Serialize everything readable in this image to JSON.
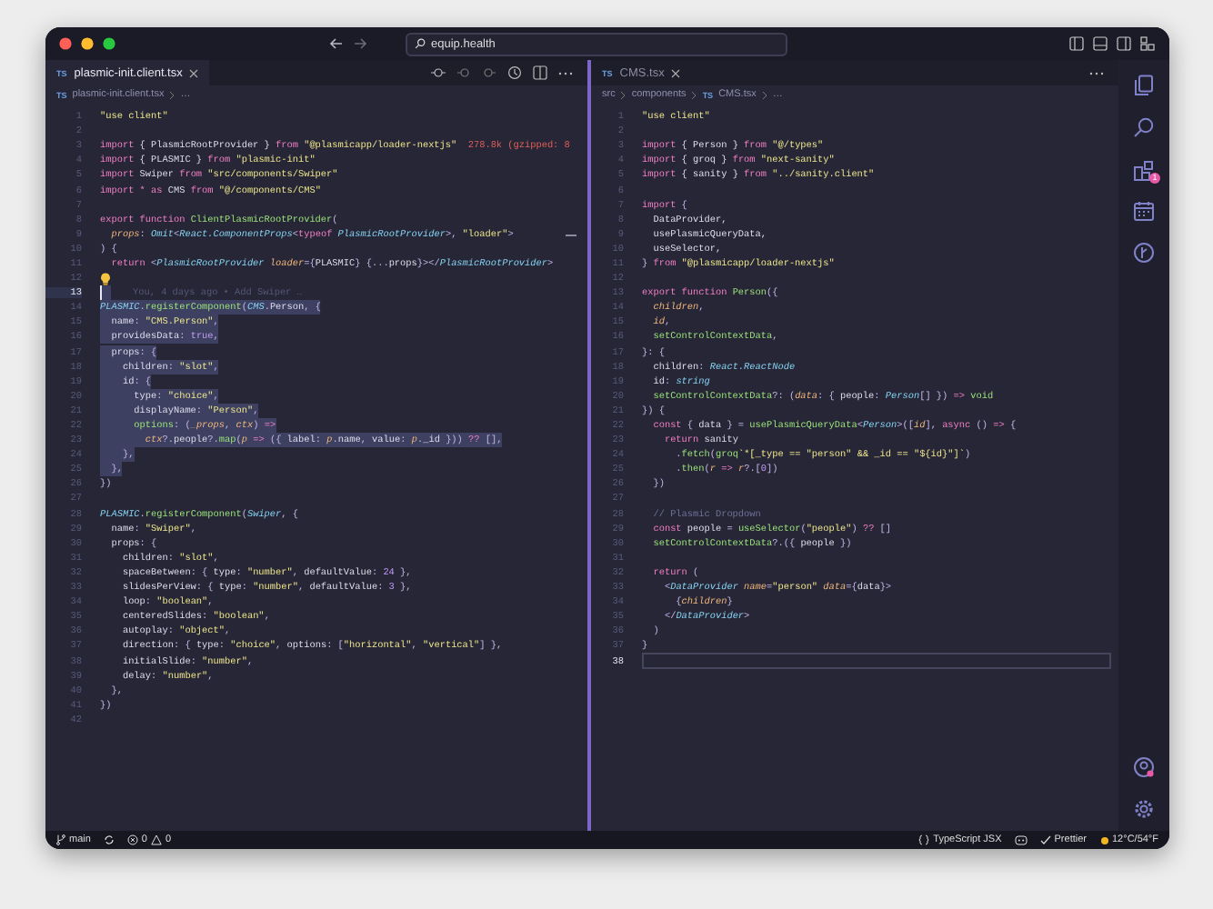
{
  "window": {
    "search": "equip.health"
  },
  "left_pane": {
    "tab": {
      "file_type": "TS",
      "label": "plasmic-init.client.tsx",
      "selected": true
    },
    "breadcrumb": {
      "file_type": "TS",
      "file": "plasmic-init.client.tsx",
      "rest": "…"
    },
    "lines": [
      {
        "number": "1",
        "kind": "code",
        "active": false,
        "selected": false,
        "tokens": [
          {
            "kind": "string",
            "text": "\"use client\""
          }
        ]
      },
      {
        "number": "2",
        "kind": "code",
        "active": false,
        "selected": false
      },
      {
        "number": "3",
        "kind": "code",
        "active": false,
        "selected": false,
        "tokens": [
          {
            "kind": "keyword",
            "text": "import"
          },
          {
            "kind": "plain",
            "text": " { PlasmicRootProvider } "
          },
          {
            "kind": "keyword",
            "text": "from"
          },
          {
            "kind": "string",
            "text": " \"@plasmicapp/loader-nextjs\""
          },
          {
            "kind": "cost",
            "text": "  278.8k (gzipped: 8"
          }
        ]
      },
      {
        "number": "4",
        "kind": "code",
        "active": false,
        "selected": false,
        "tokens": [
          {
            "kind": "keyword",
            "text": "import"
          },
          {
            "kind": "plain",
            "text": " { PLASMIC } "
          },
          {
            "kind": "keyword",
            "text": "from"
          },
          {
            "kind": "string",
            "text": " \"plasmic-init\""
          }
        ]
      },
      {
        "number": "5",
        "kind": "code",
        "active": false,
        "selected": false,
        "tokens": [
          {
            "kind": "keyword",
            "text": "import"
          },
          {
            "kind": "plain",
            "text": " Swiper "
          },
          {
            "kind": "keyword",
            "text": "from"
          },
          {
            "kind": "string",
            "text": " \"src/components/Swiper\""
          }
        ]
      },
      {
        "number": "6",
        "kind": "code",
        "active": false,
        "selected": false,
        "tokens": [
          {
            "kind": "keyword",
            "text": "import * as"
          },
          {
            "kind": "plain",
            "text": " CMS "
          },
          {
            "kind": "keyword",
            "text": "from"
          },
          {
            "kind": "string",
            "text": " \"@/components/CMS\""
          }
        ]
      },
      {
        "number": "7",
        "kind": "code",
        "active": false,
        "selected": false
      },
      {
        "number": "8",
        "kind": "code",
        "active": false,
        "selected": false,
        "tokens": [
          {
            "kind": "keyword",
            "text": "export function"
          },
          {
            "kind": "function",
            "text": " ClientPlasmicRootProvider"
          },
          {
            "kind": "punct",
            "text": "("
          }
        ]
      },
      {
        "number": "9",
        "kind": "code",
        "active": false,
        "selected": false,
        "tokens": [
          {
            "kind": "param",
            "text": "  props"
          },
          {
            "kind": "punct",
            "text": ": "
          },
          {
            "kind": "type",
            "text": "Omit"
          },
          {
            "kind": "punct",
            "text": "<"
          },
          {
            "kind": "type",
            "text": "React.ComponentProps"
          },
          {
            "kind": "punct",
            "text": "<"
          },
          {
            "kind": "keyword",
            "text": "typeof"
          },
          {
            "kind": "type",
            "text": " PlasmicRootProvider"
          },
          {
            "kind": "punct",
            "text": ">, "
          },
          {
            "kind": "string",
            "text": "\"loader\""
          },
          {
            "kind": "punct",
            "text": ">"
          }
        ]
      },
      {
        "number": "10",
        "kind": "code",
        "active": false,
        "selected": false,
        "tokens": [
          {
            "kind": "punct",
            "text": ") {"
          }
        ]
      },
      {
        "number": "11",
        "kind": "code",
        "active": false,
        "selected": false,
        "tokens": [
          {
            "kind": "keyword",
            "text": "  return"
          },
          {
            "kind": "punct",
            "text": " <"
          },
          {
            "kind": "type",
            "text": "PlasmicRootProvider"
          },
          {
            "kind": "param",
            "text": " loader"
          },
          {
            "kind": "punct",
            "text": "={"
          },
          {
            "kind": "plain",
            "text": "PLASMIC"
          },
          {
            "kind": "punct",
            "text": "} {..."
          },
          {
            "kind": "plain",
            "text": "props"
          },
          {
            "kind": "punct",
            "text": "}></"
          },
          {
            "kind": "type",
            "text": "PlasmicRootProvider"
          },
          {
            "kind": "punct",
            "text": ">"
          }
        ]
      },
      {
        "number": "12",
        "kind": "hint",
        "active": false,
        "selected": false
      },
      {
        "number": "13",
        "kind": "blame",
        "active": true,
        "selected": true,
        "blame": "You, 4 days ago • Add Swiper …"
      },
      {
        "number": "14",
        "kind": "code",
        "active": false,
        "selected": true,
        "tokens": [
          {
            "kind": "type",
            "text": "PLASMIC"
          },
          {
            "kind": "punct",
            "text": "."
          },
          {
            "kind": "function",
            "text": "registerComponent"
          },
          {
            "kind": "punct",
            "text": "("
          },
          {
            "kind": "type",
            "text": "CMS"
          },
          {
            "kind": "punct",
            "text": "."
          },
          {
            "kind": "plain",
            "text": "Person"
          },
          {
            "kind": "punct",
            "text": ", {"
          }
        ]
      },
      {
        "number": "15",
        "kind": "code",
        "active": false,
        "selected": true,
        "tokens": [
          {
            "kind": "plain",
            "text": "  name"
          },
          {
            "kind": "punct",
            "text": ": "
          },
          {
            "kind": "string",
            "text": "\"CMS.Person\""
          },
          {
            "kind": "punct",
            "text": ","
          }
        ]
      },
      {
        "number": "16",
        "kind": "code",
        "active": false,
        "selected": true,
        "tokens": [
          {
            "kind": "plain",
            "text": "  providesData"
          },
          {
            "kind": "punct",
            "text": ": "
          },
          {
            "kind": "number",
            "text": "true"
          },
          {
            "kind": "punct",
            "text": ","
          }
        ]
      },
      {
        "number": "17",
        "kind": "code",
        "active": false,
        "selected": true,
        "tokens": [
          {
            "kind": "plain",
            "text": "  props"
          },
          {
            "kind": "punct",
            "text": ": {"
          }
        ]
      },
      {
        "number": "18",
        "kind": "code",
        "active": false,
        "selected": true,
        "tokens": [
          {
            "kind": "plain",
            "text": "    children"
          },
          {
            "kind": "punct",
            "text": ": "
          },
          {
            "kind": "string",
            "text": "\"slot\""
          },
          {
            "kind": "punct",
            "text": ","
          }
        ]
      },
      {
        "number": "19",
        "kind": "code",
        "active": false,
        "selected": true,
        "tokens": [
          {
            "kind": "plain",
            "text": "    id"
          },
          {
            "kind": "punct",
            "text": ": {"
          }
        ]
      },
      {
        "number": "20",
        "kind": "code",
        "active": false,
        "selected": true,
        "tokens": [
          {
            "kind": "plain",
            "text": "      type"
          },
          {
            "kind": "punct",
            "text": ": "
          },
          {
            "kind": "string",
            "text": "\"choice\""
          },
          {
            "kind": "punct",
            "text": ","
          }
        ]
      },
      {
        "number": "21",
        "kind": "code",
        "active": false,
        "selected": true,
        "tokens": [
          {
            "kind": "plain",
            "text": "      displayName"
          },
          {
            "kind": "punct",
            "text": ": "
          },
          {
            "kind": "string",
            "text": "\"Person\""
          },
          {
            "kind": "punct",
            "text": ","
          }
        ]
      },
      {
        "number": "22",
        "kind": "code",
        "active": false,
        "selected": true,
        "tokens": [
          {
            "kind": "function",
            "text": "      options"
          },
          {
            "kind": "punct",
            "text": ": ("
          },
          {
            "kind": "param",
            "text": "_props"
          },
          {
            "kind": "punct",
            "text": ", "
          },
          {
            "kind": "param",
            "text": "ctx"
          },
          {
            "kind": "punct",
            "text": ") "
          },
          {
            "kind": "keyword",
            "text": "=>"
          }
        ]
      },
      {
        "number": "23",
        "kind": "code",
        "active": false,
        "selected": true,
        "tokens": [
          {
            "kind": "param",
            "text": "        ctx"
          },
          {
            "kind": "punct",
            "text": "?."
          },
          {
            "kind": "plain",
            "text": "people"
          },
          {
            "kind": "punct",
            "text": "?."
          },
          {
            "kind": "function",
            "text": "map"
          },
          {
            "kind": "punct",
            "text": "("
          },
          {
            "kind": "param",
            "text": "p"
          },
          {
            "kind": "keyword",
            "text": " =>"
          },
          {
            "kind": "punct",
            "text": " ({ "
          },
          {
            "kind": "plain",
            "text": "label"
          },
          {
            "kind": "punct",
            "text": ": "
          },
          {
            "kind": "param",
            "text": "p"
          },
          {
            "kind": "punct",
            "text": "."
          },
          {
            "kind": "plain",
            "text": "name"
          },
          {
            "kind": "punct",
            "text": ", "
          },
          {
            "kind": "plain",
            "text": "value"
          },
          {
            "kind": "punct",
            "text": ": "
          },
          {
            "kind": "param",
            "text": "p"
          },
          {
            "kind": "punct",
            "text": "."
          },
          {
            "kind": "plain",
            "text": "_id"
          },
          {
            "kind": "punct",
            "text": " })) "
          },
          {
            "kind": "keyword",
            "text": "??"
          },
          {
            "kind": "punct",
            "text": " [],"
          }
        ]
      },
      {
        "number": "24",
        "kind": "code",
        "active": false,
        "selected": true,
        "tokens": [
          {
            "kind": "punct",
            "text": "    },"
          }
        ]
      },
      {
        "number": "25",
        "kind": "code",
        "active": false,
        "selected": true,
        "tokens": [
          {
            "kind": "punct",
            "text": "  },"
          }
        ]
      },
      {
        "number": "26",
        "kind": "code",
        "active": false,
        "selected": false,
        "tokens": [
          {
            "kind": "punct",
            "text": "})"
          }
        ]
      },
      {
        "number": "27",
        "kind": "code",
        "active": false,
        "selected": false
      },
      {
        "number": "28",
        "kind": "code",
        "active": false,
        "selected": false,
        "tokens": [
          {
            "kind": "type",
            "text": "PLASMIC"
          },
          {
            "kind": "punct",
            "text": "."
          },
          {
            "kind": "function",
            "text": "registerComponent"
          },
          {
            "kind": "punct",
            "text": "("
          },
          {
            "kind": "type",
            "text": "Swiper"
          },
          {
            "kind": "punct",
            "text": ", {"
          }
        ]
      },
      {
        "number": "29",
        "kind": "code",
        "active": false,
        "selected": false,
        "tokens": [
          {
            "kind": "plain",
            "text": "  name"
          },
          {
            "kind": "punct",
            "text": ": "
          },
          {
            "kind": "string",
            "text": "\"Swiper\""
          },
          {
            "kind": "punct",
            "text": ","
          }
        ]
      },
      {
        "number": "30",
        "kind": "code",
        "active": false,
        "selected": false,
        "tokens": [
          {
            "kind": "plain",
            "text": "  props"
          },
          {
            "kind": "punct",
            "text": ": {"
          }
        ]
      },
      {
        "number": "31",
        "kind": "code",
        "active": false,
        "selected": false,
        "tokens": [
          {
            "kind": "plain",
            "text": "    children"
          },
          {
            "kind": "punct",
            "text": ": "
          },
          {
            "kind": "string",
            "text": "\"slot\""
          },
          {
            "kind": "punct",
            "text": ","
          }
        ]
      },
      {
        "number": "32",
        "kind": "code",
        "active": false,
        "selected": false,
        "tokens": [
          {
            "kind": "plain",
            "text": "    spaceBetween"
          },
          {
            "kind": "punct",
            "text": ": { "
          },
          {
            "kind": "plain",
            "text": "type"
          },
          {
            "kind": "punct",
            "text": ": "
          },
          {
            "kind": "string",
            "text": "\"number\""
          },
          {
            "kind": "punct",
            "text": ", "
          },
          {
            "kind": "plain",
            "text": "defaultValue"
          },
          {
            "kind": "punct",
            "text": ": "
          },
          {
            "kind": "number",
            "text": "24"
          },
          {
            "kind": "punct",
            "text": " },"
          }
        ]
      },
      {
        "number": "33",
        "kind": "code",
        "active": false,
        "selected": false,
        "tokens": [
          {
            "kind": "plain",
            "text": "    slidesPerView"
          },
          {
            "kind": "punct",
            "text": ": { "
          },
          {
            "kind": "plain",
            "text": "type"
          },
          {
            "kind": "punct",
            "text": ": "
          },
          {
            "kind": "string",
            "text": "\"number\""
          },
          {
            "kind": "punct",
            "text": ", "
          },
          {
            "kind": "plain",
            "text": "defaultValue"
          },
          {
            "kind": "punct",
            "text": ": "
          },
          {
            "kind": "number",
            "text": "3"
          },
          {
            "kind": "punct",
            "text": " },"
          }
        ]
      },
      {
        "number": "34",
        "kind": "code",
        "active": false,
        "selected": false,
        "tokens": [
          {
            "kind": "plain",
            "text": "    loop"
          },
          {
            "kind": "punct",
            "text": ": "
          },
          {
            "kind": "string",
            "text": "\"boolean\""
          },
          {
            "kind": "punct",
            "text": ","
          }
        ]
      },
      {
        "number": "35",
        "kind": "code",
        "active": false,
        "selected": false,
        "tokens": [
          {
            "kind": "plain",
            "text": "    centeredSlides"
          },
          {
            "kind": "punct",
            "text": ": "
          },
          {
            "kind": "string",
            "text": "\"boolean\""
          },
          {
            "kind": "punct",
            "text": ","
          }
        ]
      },
      {
        "number": "36",
        "kind": "code",
        "active": false,
        "selected": false,
        "tokens": [
          {
            "kind": "plain",
            "text": "    autoplay"
          },
          {
            "kind": "punct",
            "text": ": "
          },
          {
            "kind": "string",
            "text": "\"object\""
          },
          {
            "kind": "punct",
            "text": ","
          }
        ]
      },
      {
        "number": "37",
        "kind": "code",
        "active": false,
        "selected": false,
        "tokens": [
          {
            "kind": "plain",
            "text": "    direction"
          },
          {
            "kind": "punct",
            "text": ": { "
          },
          {
            "kind": "plain",
            "text": "type"
          },
          {
            "kind": "punct",
            "text": ": "
          },
          {
            "kind": "string",
            "text": "\"choice\""
          },
          {
            "kind": "punct",
            "text": ", "
          },
          {
            "kind": "plain",
            "text": "options"
          },
          {
            "kind": "punct",
            "text": ": ["
          },
          {
            "kind": "string",
            "text": "\"horizontal\""
          },
          {
            "kind": "punct",
            "text": ", "
          },
          {
            "kind": "string",
            "text": "\"vertical\""
          },
          {
            "kind": "punct",
            "text": "] },"
          }
        ]
      },
      {
        "number": "38",
        "kind": "code",
        "active": false,
        "selected": false,
        "tokens": [
          {
            "kind": "plain",
            "text": "    initialSlide"
          },
          {
            "kind": "punct",
            "text": ": "
          },
          {
            "kind": "string",
            "text": "\"number\""
          },
          {
            "kind": "punct",
            "text": ","
          }
        ]
      },
      {
        "number": "39",
        "kind": "code",
        "active": false,
        "selected": false,
        "tokens": [
          {
            "kind": "plain",
            "text": "    delay"
          },
          {
            "kind": "punct",
            "text": ": "
          },
          {
            "kind": "string",
            "text": "\"number\""
          },
          {
            "kind": "punct",
            "text": ","
          }
        ]
      },
      {
        "number": "40",
        "kind": "code",
        "active": false,
        "selected": false,
        "tokens": [
          {
            "kind": "punct",
            "text": "  },"
          }
        ]
      },
      {
        "number": "41",
        "kind": "code",
        "active": false,
        "selected": false,
        "tokens": [
          {
            "kind": "punct",
            "text": "})"
          }
        ]
      },
      {
        "number": "42",
        "kind": "code",
        "active": false,
        "selected": false
      }
    ]
  },
  "right_pane": {
    "tab": {
      "file_type": "TS",
      "label": "CMS.tsx",
      "selected": false
    },
    "breadcrumb": {
      "path": [
        "src",
        "components"
      ],
      "file_type": "TS",
      "file": "CMS.tsx",
      "rest": "…"
    },
    "lines": [
      {
        "number": "1",
        "kind": "code",
        "active": false,
        "selected": false,
        "tokens": [
          {
            "kind": "string",
            "text": "\"use client\""
          }
        ]
      },
      {
        "number": "2",
        "kind": "code",
        "active": false,
        "selected": false
      },
      {
        "number": "3",
        "kind": "code",
        "active": false,
        "selected": false,
        "tokens": [
          {
            "kind": "keyword",
            "text": "import"
          },
          {
            "kind": "plain",
            "text": " { Person } "
          },
          {
            "kind": "keyword",
            "text": "from"
          },
          {
            "kind": "string",
            "text": " \"@/types\""
          }
        ]
      },
      {
        "number": "4",
        "kind": "code",
        "active": false,
        "selected": false,
        "tokens": [
          {
            "kind": "keyword",
            "text": "import"
          },
          {
            "kind": "plain",
            "text": " { groq } "
          },
          {
            "kind": "keyword",
            "text": "from"
          },
          {
            "kind": "string",
            "text": " \"next-sanity\""
          }
        ]
      },
      {
        "number": "5",
        "kind": "code",
        "active": false,
        "selected": false,
        "tokens": [
          {
            "kind": "keyword",
            "text": "import"
          },
          {
            "kind": "plain",
            "text": " { sanity } "
          },
          {
            "kind": "keyword",
            "text": "from"
          },
          {
            "kind": "string",
            "text": " \"../sanity.client\""
          }
        ]
      },
      {
        "number": "6",
        "kind": "code",
        "active": false,
        "selected": false
      },
      {
        "number": "7",
        "kind": "code",
        "active": false,
        "selected": false,
        "tokens": [
          {
            "kind": "keyword",
            "text": "import"
          },
          {
            "kind": "punct",
            "text": " {"
          }
        ]
      },
      {
        "number": "8",
        "kind": "code",
        "active": false,
        "selected": false,
        "tokens": [
          {
            "kind": "plain",
            "text": "  DataProvider,"
          }
        ]
      },
      {
        "number": "9",
        "kind": "code",
        "active": false,
        "selected": false,
        "tokens": [
          {
            "kind": "plain",
            "text": "  usePlasmicQueryData,"
          }
        ]
      },
      {
        "number": "10",
        "kind": "code",
        "active": false,
        "selected": false,
        "tokens": [
          {
            "kind": "plain",
            "text": "  useSelector,"
          }
        ]
      },
      {
        "number": "11",
        "kind": "code",
        "active": false,
        "selected": false,
        "tokens": [
          {
            "kind": "punct",
            "text": "} "
          },
          {
            "kind": "keyword",
            "text": "from"
          },
          {
            "kind": "string",
            "text": " \"@plasmicapp/loader-nextjs\""
          }
        ]
      },
      {
        "number": "12",
        "kind": "code",
        "active": false,
        "selected": false
      },
      {
        "number": "13",
        "kind": "code",
        "active": false,
        "selected": false,
        "tokens": [
          {
            "kind": "keyword",
            "text": "export function"
          },
          {
            "kind": "function",
            "text": " Person"
          },
          {
            "kind": "punct",
            "text": "({"
          }
        ]
      },
      {
        "number": "14",
        "kind": "code",
        "active": false,
        "selected": false,
        "tokens": [
          {
            "kind": "param",
            "text": "  children"
          },
          {
            "kind": "punct",
            "text": ","
          }
        ]
      },
      {
        "number": "15",
        "kind": "code",
        "active": false,
        "selected": false,
        "tokens": [
          {
            "kind": "param",
            "text": "  id"
          },
          {
            "kind": "punct",
            "text": ","
          }
        ]
      },
      {
        "number": "16",
        "kind": "code",
        "active": false,
        "selected": false,
        "tokens": [
          {
            "kind": "function",
            "text": "  setControlContextData"
          },
          {
            "kind": "punct",
            "text": ","
          }
        ]
      },
      {
        "number": "17",
        "kind": "code",
        "active": false,
        "selected": false,
        "tokens": [
          {
            "kind": "punct",
            "text": "}: {"
          }
        ]
      },
      {
        "number": "18",
        "kind": "code",
        "active": false,
        "selected": false,
        "tokens": [
          {
            "kind": "plain",
            "text": "  children"
          },
          {
            "kind": "punct",
            "text": ": "
          },
          {
            "kind": "type",
            "text": "React.ReactNode"
          }
        ]
      },
      {
        "number": "19",
        "kind": "code",
        "active": false,
        "selected": false,
        "tokens": [
          {
            "kind": "plain",
            "text": "  id"
          },
          {
            "kind": "punct",
            "text": ": "
          },
          {
            "kind": "type",
            "text": "string"
          }
        ]
      },
      {
        "number": "20",
        "kind": "code",
        "active": false,
        "selected": false,
        "tokens": [
          {
            "kind": "function",
            "text": "  setControlContextData"
          },
          {
            "kind": "punct",
            "text": "?: ("
          },
          {
            "kind": "param",
            "text": "data"
          },
          {
            "kind": "punct",
            "text": ": { "
          },
          {
            "kind": "plain",
            "text": "people"
          },
          {
            "kind": "punct",
            "text": ": "
          },
          {
            "kind": "type",
            "text": "Person"
          },
          {
            "kind": "punct",
            "text": "[] }) "
          },
          {
            "kind": "keyword",
            "text": "=>"
          },
          {
            "kind": "function",
            "text": " void"
          }
        ]
      },
      {
        "number": "21",
        "kind": "code",
        "active": false,
        "selected": false,
        "tokens": [
          {
            "kind": "punct",
            "text": "}) {"
          }
        ]
      },
      {
        "number": "22",
        "kind": "code",
        "active": false,
        "selected": false,
        "tokens": [
          {
            "kind": "keyword",
            "text": "  const"
          },
          {
            "kind": "punct",
            "text": " { "
          },
          {
            "kind": "plain",
            "text": "data"
          },
          {
            "kind": "punct",
            "text": " } = "
          },
          {
            "kind": "function",
            "text": "usePlasmicQueryData"
          },
          {
            "kind": "punct",
            "text": "<"
          },
          {
            "kind": "type",
            "text": "Person"
          },
          {
            "kind": "punct",
            "text": ">(["
          },
          {
            "kind": "param",
            "text": "id"
          },
          {
            "kind": "punct",
            "text": "], "
          },
          {
            "kind": "keyword",
            "text": "async"
          },
          {
            "kind": "punct",
            "text": " () "
          },
          {
            "kind": "keyword",
            "text": "=>"
          },
          {
            "kind": "punct",
            "text": " {"
          }
        ]
      },
      {
        "number": "23",
        "kind": "code",
        "active": false,
        "selected": false,
        "tokens": [
          {
            "kind": "keyword",
            "text": "    return"
          },
          {
            "kind": "plain",
            "text": " sanity"
          }
        ]
      },
      {
        "number": "24",
        "kind": "code",
        "active": false,
        "selected": false,
        "tokens": [
          {
            "kind": "punct",
            "text": "      ."
          },
          {
            "kind": "function",
            "text": "fetch"
          },
          {
            "kind": "punct",
            "text": "("
          },
          {
            "kind": "function",
            "text": "groq"
          },
          {
            "kind": "string",
            "text": "`*[_type == \"person\" && _id == \"${id}\"]`"
          },
          {
            "kind": "punct",
            "text": ")"
          }
        ]
      },
      {
        "number": "25",
        "kind": "code",
        "active": false,
        "selected": false,
        "tokens": [
          {
            "kind": "punct",
            "text": "      ."
          },
          {
            "kind": "function",
            "text": "then"
          },
          {
            "kind": "punct",
            "text": "("
          },
          {
            "kind": "param",
            "text": "r"
          },
          {
            "kind": "keyword",
            "text": " =>"
          },
          {
            "kind": "param",
            "text": " r"
          },
          {
            "kind": "punct",
            "text": "?.["
          },
          {
            "kind": "number",
            "text": "0"
          },
          {
            "kind": "punct",
            "text": "])"
          }
        ]
      },
      {
        "number": "26",
        "kind": "code",
        "active": false,
        "selected": false,
        "tokens": [
          {
            "kind": "punct",
            "text": "  })"
          }
        ]
      },
      {
        "number": "27",
        "kind": "code",
        "active": false,
        "selected": false
      },
      {
        "number": "28",
        "kind": "code",
        "active": false,
        "selected": false,
        "tokens": [
          {
            "kind": "comment",
            "text": "  // Plasmic Dropdown"
          }
        ]
      },
      {
        "number": "29",
        "kind": "code",
        "active": false,
        "selected": false,
        "tokens": [
          {
            "kind": "keyword",
            "text": "  const"
          },
          {
            "kind": "plain",
            "text": " people "
          },
          {
            "kind": "punct",
            "text": "= "
          },
          {
            "kind": "function",
            "text": "useSelector"
          },
          {
            "kind": "punct",
            "text": "("
          },
          {
            "kind": "string",
            "text": "\"people\""
          },
          {
            "kind": "punct",
            "text": ") "
          },
          {
            "kind": "keyword",
            "text": "??"
          },
          {
            "kind": "punct",
            "text": " []"
          }
        ]
      },
      {
        "number": "30",
        "kind": "code",
        "active": false,
        "selected": false,
        "tokens": [
          {
            "kind": "function",
            "text": "  setControlContextData"
          },
          {
            "kind": "punct",
            "text": "?.({ "
          },
          {
            "kind": "plain",
            "text": "people"
          },
          {
            "kind": "punct",
            "text": " })"
          }
        ]
      },
      {
        "number": "31",
        "kind": "code",
        "active": false,
        "selected": false
      },
      {
        "number": "32",
        "kind": "code",
        "active": false,
        "selected": false,
        "tokens": [
          {
            "kind": "keyword",
            "text": "  return"
          },
          {
            "kind": "punct",
            "text": " ("
          }
        ]
      },
      {
        "number": "33",
        "kind": "code",
        "active": false,
        "selected": false,
        "tokens": [
          {
            "kind": "punct",
            "text": "    <"
          },
          {
            "kind": "type",
            "text": "DataProvider"
          },
          {
            "kind": "param",
            "text": " name"
          },
          {
            "kind": "punct",
            "text": "="
          },
          {
            "kind": "string",
            "text": "\"person\""
          },
          {
            "kind": "param",
            "text": " data"
          },
          {
            "kind": "punct",
            "text": "={"
          },
          {
            "kind": "plain",
            "text": "data"
          },
          {
            "kind": "punct",
            "text": "}>"
          }
        ]
      },
      {
        "number": "34",
        "kind": "code",
        "active": false,
        "selected": false,
        "tokens": [
          {
            "kind": "punct",
            "text": "      {"
          },
          {
            "kind": "param",
            "text": "children"
          },
          {
            "kind": "punct",
            "text": "}"
          }
        ]
      },
      {
        "number": "35",
        "kind": "code",
        "active": false,
        "selected": false,
        "tokens": [
          {
            "kind": "punct",
            "text": "    </"
          },
          {
            "kind": "type",
            "text": "DataProvider"
          },
          {
            "kind": "punct",
            "text": ">"
          }
        ]
      },
      {
        "number": "36",
        "kind": "code",
        "active": false,
        "selected": false,
        "tokens": [
          {
            "kind": "punct",
            "text": "  )"
          }
        ]
      },
      {
        "number": "37",
        "kind": "code",
        "active": false,
        "selected": false,
        "tokens": [
          {
            "kind": "punct",
            "text": "}"
          }
        ]
      },
      {
        "number": "38",
        "kind": "code",
        "active": true,
        "selected": false
      }
    ]
  },
  "activity_bar": {
    "extensions_badge": "1"
  },
  "status_bar": {
    "branch": "main",
    "errors": "0",
    "warnings": "0",
    "language": "TypeScript JSX",
    "formatter": "Prettier",
    "weather": "12°C/54°F"
  }
}
